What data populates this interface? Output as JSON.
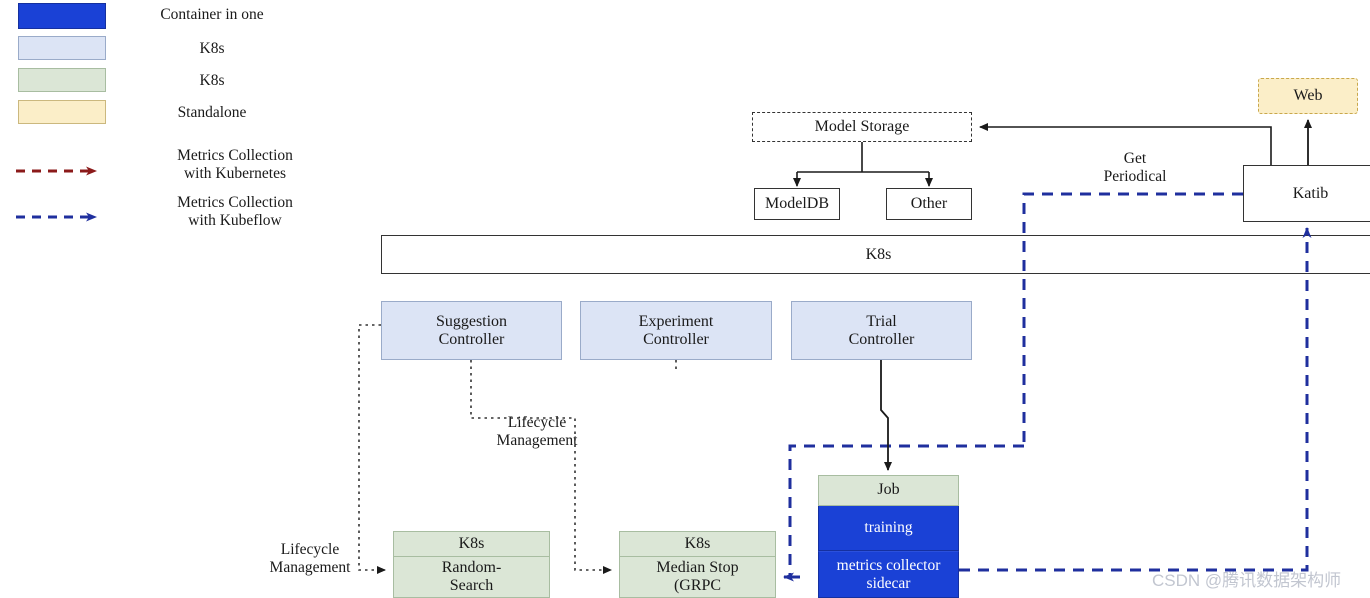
{
  "legend": {
    "swatches": [
      {
        "label": "Container in one",
        "color": "#1a41d6",
        "kind": "blue"
      },
      {
        "label": "K8s",
        "color": "#dce4f5",
        "kind": "light-blue"
      },
      {
        "label": "K8s",
        "color": "#dbe6d6",
        "kind": "light-green"
      },
      {
        "label": "Standalone",
        "color": "#fbeec8",
        "kind": "light-yellow"
      }
    ],
    "arrows": [
      {
        "label": "Metrics Collection\nwith Kubernetes",
        "line1": "Metrics Collection",
        "line2": "with Kubernetes",
        "color": "#8b1a1a"
      },
      {
        "label": "Metrics Collection\nwith Kubeflow",
        "line1": "Metrics Collection",
        "line2": "with Kubeflow",
        "color": "#1f2f9e"
      }
    ]
  },
  "nodes": {
    "model_storage": "Model Storage",
    "modeldb": "ModelDB",
    "other": "Other",
    "web": "Web",
    "katib": "Katib",
    "k8s_bar": "K8s",
    "suggestion_controller_line1": "Suggestion",
    "suggestion_controller_line2": "Controller",
    "experiment_controller_line1": "Experiment",
    "experiment_controller_line2": "Controller",
    "trial_controller_line1": "Trial",
    "trial_controller_line2": "Controller",
    "job_header": "Job",
    "job_training": "training",
    "job_metrics_line1": "metrics collector",
    "job_metrics_line2": "sidecar",
    "random_search_header": "K8s",
    "random_search_line1": "Random-",
    "random_search_line2": "Search",
    "median_stop_header": "K8s",
    "median_stop_line1": "Median Stop",
    "median_stop_line2": "(GRPC"
  },
  "edge_labels": {
    "get_periodical_line1": "Get",
    "get_periodical_line2": "Periodical",
    "lifecycle_mid_line1": "Lifecycle",
    "lifecycle_mid_line2": "Management",
    "lifecycle_left_line1": "Lifecycle",
    "lifecycle_left_line2": "Management"
  },
  "watermark": "CSDN @腾讯数据架构师",
  "colors": {
    "container_blue": "#1a41d6",
    "k8s_light_blue": "#dce4f5",
    "k8s_light_green": "#dbe6d6",
    "standalone_yellow": "#fbeec8",
    "kubernetes_arrow": "#8b1a1a",
    "kubeflow_arrow": "#1f2f9e",
    "stroke_dark": "#333333"
  }
}
